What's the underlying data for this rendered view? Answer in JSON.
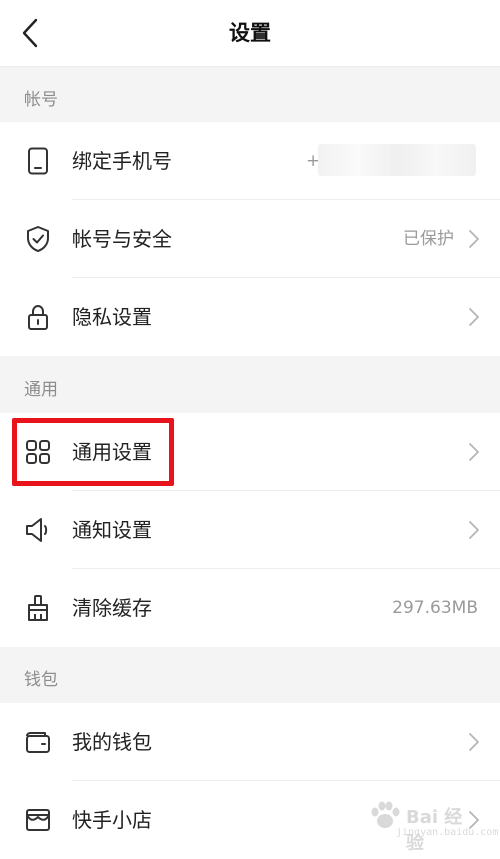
{
  "header": {
    "title": "设置",
    "back_icon": "chevron-left-icon"
  },
  "sections": [
    {
      "title": "帐号",
      "rows": [
        {
          "label": "绑定手机号",
          "value": "+",
          "icon": "phone-icon",
          "chevron": false
        },
        {
          "label": "帐号与安全",
          "value": "已保护",
          "icon": "shield-icon",
          "chevron": true
        },
        {
          "label": "隐私设置",
          "value": "",
          "icon": "lock-icon",
          "chevron": true
        }
      ]
    },
    {
      "title": "通用",
      "rows": [
        {
          "label": "通用设置",
          "value": "",
          "icon": "grid-icon",
          "chevron": true,
          "highlighted": true
        },
        {
          "label": "通知设置",
          "value": "",
          "icon": "speaker-icon",
          "chevron": true
        },
        {
          "label": "清除缓存",
          "value": "297.63MB",
          "icon": "broom-icon",
          "chevron": false
        }
      ]
    },
    {
      "title": "钱包",
      "rows": [
        {
          "label": "我的钱包",
          "value": "",
          "icon": "wallet-icon",
          "chevron": true
        },
        {
          "label": "快手小店",
          "value": "",
          "icon": "store-icon",
          "chevron": true
        }
      ]
    }
  ],
  "watermark": {
    "text": "Bai 经验",
    "subtext": "jingyan.baidu.com"
  },
  "colors": {
    "highlight": "#e8131b",
    "section_bg": "#f4f4f4",
    "secondary_text": "#9a9a9a"
  }
}
